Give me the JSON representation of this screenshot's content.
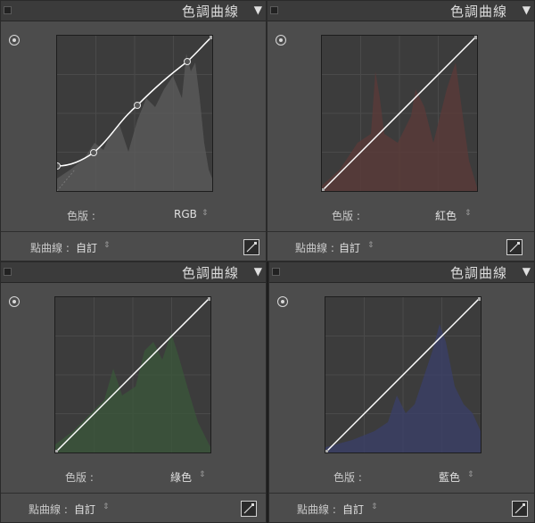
{
  "panels": [
    {
      "title": "色調曲線",
      "channel_label": "色版 :",
      "channel_value": "RGB",
      "curve_label": "點曲線 :",
      "curve_value": "自訂"
    },
    {
      "title": "色調曲線",
      "channel_label": "色版 :",
      "channel_value": "紅色",
      "curve_label": "點曲線 :",
      "curve_value": "自訂"
    },
    {
      "title": "色調曲線",
      "channel_label": "色版 :",
      "channel_value": "綠色",
      "curve_label": "點曲線 :",
      "curve_value": "自訂"
    },
    {
      "title": "色調曲線",
      "channel_label": "色版 :",
      "channel_value": "藍色",
      "curve_label": "點曲線 :",
      "curve_value": "自訂"
    }
  ],
  "icons": {
    "collapse": "triangle-down-icon",
    "target": "target-adjust-icon",
    "edit_curve": "edit-point-curve-icon",
    "stepper": "up-down-arrows-icon"
  },
  "colors": {
    "histogram_rgb": "#5a5a5a",
    "histogram_red": "#5a3a38",
    "histogram_green": "#3a553a",
    "histogram_blue": "#3a3e66",
    "curve": "#ffffff"
  }
}
